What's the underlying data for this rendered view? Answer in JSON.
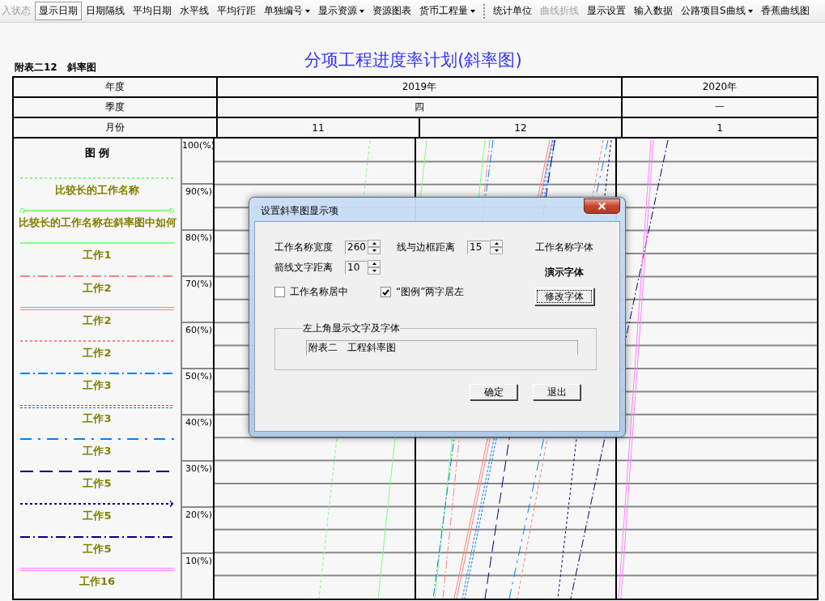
{
  "toolbar": [
    {
      "label": "入状态",
      "disabled": true,
      "selected": false,
      "dropdown": false
    },
    {
      "label": "显示日期",
      "disabled": false,
      "selected": true,
      "dropdown": false
    },
    {
      "label": "日期隔线",
      "disabled": false,
      "selected": false,
      "dropdown": false
    },
    {
      "label": "平均日期",
      "disabled": false,
      "selected": false,
      "dropdown": false
    },
    {
      "label": "水平线",
      "disabled": false,
      "selected": false,
      "dropdown": false
    },
    {
      "label": "平均行距",
      "disabled": false,
      "selected": false,
      "dropdown": false
    },
    {
      "label": "单独编号",
      "disabled": false,
      "selected": false,
      "dropdown": true
    },
    {
      "label": "显示资源",
      "disabled": false,
      "selected": false,
      "dropdown": true
    },
    {
      "label": "资源图表",
      "disabled": false,
      "selected": false,
      "dropdown": false
    },
    {
      "label": "货币工程量",
      "disabled": false,
      "selected": false,
      "dropdown": true
    },
    {
      "label": "统计单位",
      "disabled": false,
      "selected": false,
      "dropdown": false
    },
    {
      "label": "曲线折线",
      "disabled": true,
      "selected": false,
      "dropdown": false
    },
    {
      "label": "显示设置",
      "disabled": false,
      "selected": false,
      "dropdown": false
    },
    {
      "label": "输入数据",
      "disabled": false,
      "selected": false,
      "dropdown": false
    },
    {
      "label": "公路项目S曲线",
      "disabled": false,
      "selected": false,
      "dropdown": true
    },
    {
      "label": "香蕉曲线图",
      "disabled": false,
      "selected": false,
      "dropdown": false
    }
  ],
  "report": {
    "caption": "附表二12　斜率图",
    "title": "分项工程进度率计划(斜率图)"
  },
  "table": {
    "row_headers": [
      "年度",
      "季度",
      "月份"
    ],
    "years": [
      {
        "label": "2019年",
        "quarters": [
          {
            "label": "四",
            "months": [
              "11",
              "12"
            ]
          }
        ]
      },
      {
        "label": "2020年",
        "quarters": [
          {
            "label": "一",
            "months": [
              "1"
            ]
          }
        ]
      }
    ]
  },
  "legend": {
    "title": "图 例",
    "items": [
      {
        "label": "比较长的工作名称",
        "kind": "dashed",
        "color": "#80ff80"
      },
      {
        "label": "比较长的工作名称在斜率图中如何",
        "kind": "circles",
        "color": "#80ff80"
      },
      {
        "label": "工作1",
        "kind": "solid",
        "color": "#80ff80"
      },
      {
        "label": "工作2",
        "kind": "dashdot",
        "color": "#ff8080"
      },
      {
        "label": "工作2",
        "kind": "double",
        "color": "#ff8080"
      },
      {
        "label": "工作2",
        "kind": "dashed",
        "color": "#ff8080"
      },
      {
        "label": "工作3",
        "kind": "dashdot",
        "color": "#0080ff"
      },
      {
        "label": "工作3",
        "kind": "doubledotted",
        "color": "#0080ff"
      },
      {
        "label": "工作3",
        "kind": "longdashdot",
        "color": "#0080ff"
      },
      {
        "label": "工作5",
        "kind": "longdash",
        "color": "#000080"
      },
      {
        "label": "工作5",
        "kind": "arrow",
        "color": "#000080"
      },
      {
        "label": "工作5",
        "kind": "dashdot",
        "color": "#000080"
      },
      {
        "label": "工作16",
        "kind": "double",
        "color": "#ff80ff"
      }
    ]
  },
  "y_axis": [
    "100(%)",
    "90(%)",
    "80(%)",
    "70(%)",
    "60(%)",
    "50(%)",
    "40(%)",
    "30(%)",
    "20(%)",
    "10(%)"
  ],
  "dialog": {
    "title": "设置斜率图显示项",
    "fields": [
      {
        "label": "工作名称宽度",
        "value": "260"
      },
      {
        "label": "线与边框距离",
        "value": "15"
      },
      {
        "label": "箭线文字距离",
        "value": "10"
      }
    ],
    "checkboxes": [
      {
        "label": "工作名称居中",
        "checked": false
      },
      {
        "label": "“图例”两字居左",
        "checked": true
      }
    ],
    "font_label": "工作名称字体",
    "font_sample": "演示字体",
    "font_button": "修改字体",
    "group": {
      "title": "左上角显示文字及字体",
      "value": "附表二　工程斜率图"
    },
    "buttons": [
      "确定",
      "退出"
    ]
  }
}
